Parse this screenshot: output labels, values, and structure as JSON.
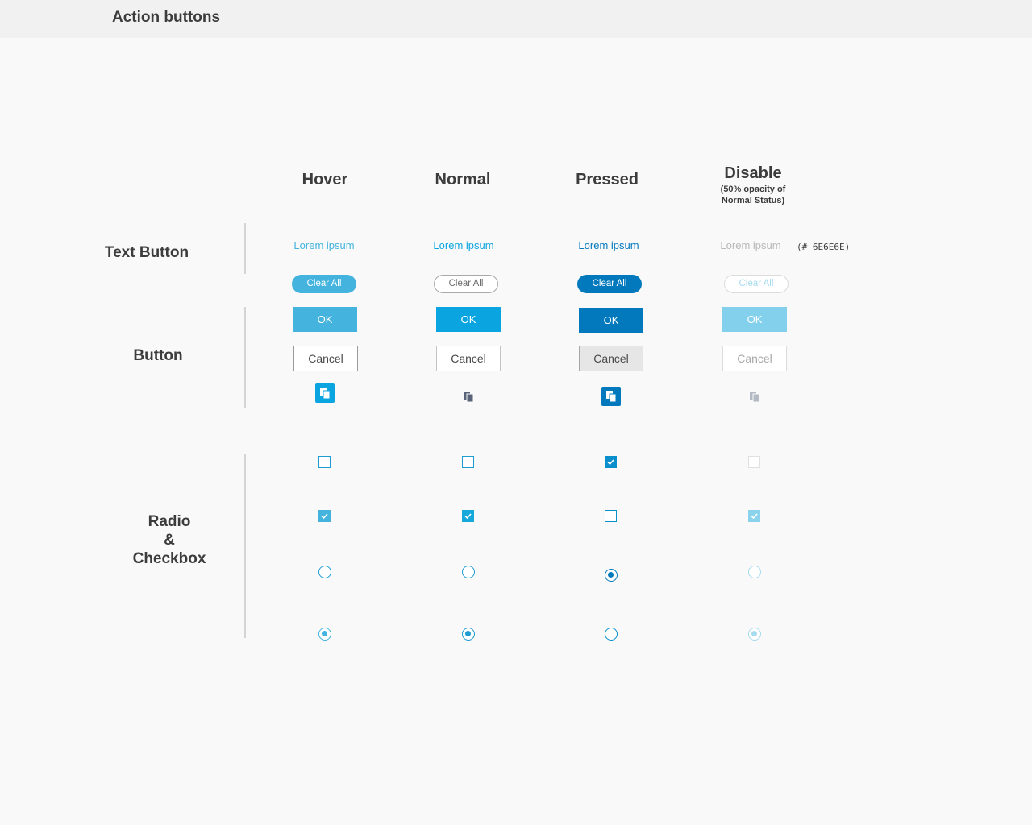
{
  "header": {
    "title": "Action buttons"
  },
  "columns": {
    "hover": "Hover",
    "normal": "Normal",
    "pressed": "Pressed",
    "disable": "Disable",
    "disable_note_line1": "(50% opacity of",
    "disable_note_line2": "Normal Status)"
  },
  "rows": {
    "text_button": "Text Button",
    "button": "Button",
    "radio_checkbox_line1": "Radio",
    "radio_checkbox_line2": "&",
    "radio_checkbox_line3": "Checkbox"
  },
  "text_buttons": {
    "hover": "Lorem ipsum",
    "normal": "Lorem ipsum",
    "pressed": "Lorem ipsum",
    "disable": "Lorem ipsum",
    "disable_color_note": "(# 6E6E6E)"
  },
  "clear_all": {
    "hover": "Clear All",
    "normal": "Clear All",
    "pressed": "Clear All",
    "disable": "Clear All"
  },
  "ok": {
    "hover": "OK",
    "normal": "OK",
    "pressed": "OK",
    "disable": "OK"
  },
  "cancel": {
    "hover": "Cancel",
    "normal": "Cancel",
    "pressed": "Cancel",
    "disable": "Cancel"
  },
  "icons": {
    "copy": "copy-icon"
  },
  "colors": {
    "hover_blue": "#44b4de",
    "normal_blue": "#0aa5e0",
    "pressed_blue": "#0279bd",
    "disabled_blue": "#82d0ec",
    "disabled_text": "#6E6E6E"
  },
  "states": {
    "checkbox_row1": {
      "hover": false,
      "normal": false,
      "pressed": true,
      "disable": false
    },
    "checkbox_row2": {
      "hover": true,
      "normal": true,
      "pressed": false,
      "disable": true
    },
    "radio_row1": {
      "hover": false,
      "normal": false,
      "pressed": true,
      "disable": false
    },
    "radio_row2": {
      "hover": true,
      "normal": true,
      "pressed": false,
      "disable": true
    }
  }
}
